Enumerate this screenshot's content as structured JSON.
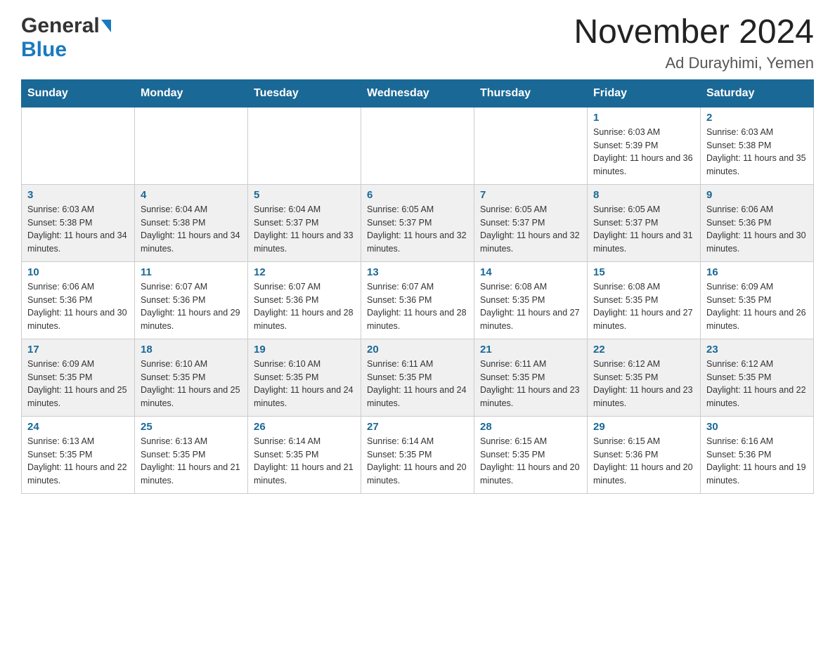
{
  "header": {
    "logo_general": "General",
    "logo_blue": "Blue",
    "title": "November 2024",
    "location": "Ad Durayhimi, Yemen"
  },
  "days_of_week": [
    "Sunday",
    "Monday",
    "Tuesday",
    "Wednesday",
    "Thursday",
    "Friday",
    "Saturday"
  ],
  "weeks": [
    [
      {
        "day": "",
        "sunrise": "",
        "sunset": "",
        "daylight": ""
      },
      {
        "day": "",
        "sunrise": "",
        "sunset": "",
        "daylight": ""
      },
      {
        "day": "",
        "sunrise": "",
        "sunset": "",
        "daylight": ""
      },
      {
        "day": "",
        "sunrise": "",
        "sunset": "",
        "daylight": ""
      },
      {
        "day": "",
        "sunrise": "",
        "sunset": "",
        "daylight": ""
      },
      {
        "day": "1",
        "sunrise": "Sunrise: 6:03 AM",
        "sunset": "Sunset: 5:39 PM",
        "daylight": "Daylight: 11 hours and 36 minutes."
      },
      {
        "day": "2",
        "sunrise": "Sunrise: 6:03 AM",
        "sunset": "Sunset: 5:38 PM",
        "daylight": "Daylight: 11 hours and 35 minutes."
      }
    ],
    [
      {
        "day": "3",
        "sunrise": "Sunrise: 6:03 AM",
        "sunset": "Sunset: 5:38 PM",
        "daylight": "Daylight: 11 hours and 34 minutes."
      },
      {
        "day": "4",
        "sunrise": "Sunrise: 6:04 AM",
        "sunset": "Sunset: 5:38 PM",
        "daylight": "Daylight: 11 hours and 34 minutes."
      },
      {
        "day": "5",
        "sunrise": "Sunrise: 6:04 AM",
        "sunset": "Sunset: 5:37 PM",
        "daylight": "Daylight: 11 hours and 33 minutes."
      },
      {
        "day": "6",
        "sunrise": "Sunrise: 6:05 AM",
        "sunset": "Sunset: 5:37 PM",
        "daylight": "Daylight: 11 hours and 32 minutes."
      },
      {
        "day": "7",
        "sunrise": "Sunrise: 6:05 AM",
        "sunset": "Sunset: 5:37 PM",
        "daylight": "Daylight: 11 hours and 32 minutes."
      },
      {
        "day": "8",
        "sunrise": "Sunrise: 6:05 AM",
        "sunset": "Sunset: 5:37 PM",
        "daylight": "Daylight: 11 hours and 31 minutes."
      },
      {
        "day": "9",
        "sunrise": "Sunrise: 6:06 AM",
        "sunset": "Sunset: 5:36 PM",
        "daylight": "Daylight: 11 hours and 30 minutes."
      }
    ],
    [
      {
        "day": "10",
        "sunrise": "Sunrise: 6:06 AM",
        "sunset": "Sunset: 5:36 PM",
        "daylight": "Daylight: 11 hours and 30 minutes."
      },
      {
        "day": "11",
        "sunrise": "Sunrise: 6:07 AM",
        "sunset": "Sunset: 5:36 PM",
        "daylight": "Daylight: 11 hours and 29 minutes."
      },
      {
        "day": "12",
        "sunrise": "Sunrise: 6:07 AM",
        "sunset": "Sunset: 5:36 PM",
        "daylight": "Daylight: 11 hours and 28 minutes."
      },
      {
        "day": "13",
        "sunrise": "Sunrise: 6:07 AM",
        "sunset": "Sunset: 5:36 PM",
        "daylight": "Daylight: 11 hours and 28 minutes."
      },
      {
        "day": "14",
        "sunrise": "Sunrise: 6:08 AM",
        "sunset": "Sunset: 5:35 PM",
        "daylight": "Daylight: 11 hours and 27 minutes."
      },
      {
        "day": "15",
        "sunrise": "Sunrise: 6:08 AM",
        "sunset": "Sunset: 5:35 PM",
        "daylight": "Daylight: 11 hours and 27 minutes."
      },
      {
        "day": "16",
        "sunrise": "Sunrise: 6:09 AM",
        "sunset": "Sunset: 5:35 PM",
        "daylight": "Daylight: 11 hours and 26 minutes."
      }
    ],
    [
      {
        "day": "17",
        "sunrise": "Sunrise: 6:09 AM",
        "sunset": "Sunset: 5:35 PM",
        "daylight": "Daylight: 11 hours and 25 minutes."
      },
      {
        "day": "18",
        "sunrise": "Sunrise: 6:10 AM",
        "sunset": "Sunset: 5:35 PM",
        "daylight": "Daylight: 11 hours and 25 minutes."
      },
      {
        "day": "19",
        "sunrise": "Sunrise: 6:10 AM",
        "sunset": "Sunset: 5:35 PM",
        "daylight": "Daylight: 11 hours and 24 minutes."
      },
      {
        "day": "20",
        "sunrise": "Sunrise: 6:11 AM",
        "sunset": "Sunset: 5:35 PM",
        "daylight": "Daylight: 11 hours and 24 minutes."
      },
      {
        "day": "21",
        "sunrise": "Sunrise: 6:11 AM",
        "sunset": "Sunset: 5:35 PM",
        "daylight": "Daylight: 11 hours and 23 minutes."
      },
      {
        "day": "22",
        "sunrise": "Sunrise: 6:12 AM",
        "sunset": "Sunset: 5:35 PM",
        "daylight": "Daylight: 11 hours and 23 minutes."
      },
      {
        "day": "23",
        "sunrise": "Sunrise: 6:12 AM",
        "sunset": "Sunset: 5:35 PM",
        "daylight": "Daylight: 11 hours and 22 minutes."
      }
    ],
    [
      {
        "day": "24",
        "sunrise": "Sunrise: 6:13 AM",
        "sunset": "Sunset: 5:35 PM",
        "daylight": "Daylight: 11 hours and 22 minutes."
      },
      {
        "day": "25",
        "sunrise": "Sunrise: 6:13 AM",
        "sunset": "Sunset: 5:35 PM",
        "daylight": "Daylight: 11 hours and 21 minutes."
      },
      {
        "day": "26",
        "sunrise": "Sunrise: 6:14 AM",
        "sunset": "Sunset: 5:35 PM",
        "daylight": "Daylight: 11 hours and 21 minutes."
      },
      {
        "day": "27",
        "sunrise": "Sunrise: 6:14 AM",
        "sunset": "Sunset: 5:35 PM",
        "daylight": "Daylight: 11 hours and 20 minutes."
      },
      {
        "day": "28",
        "sunrise": "Sunrise: 6:15 AM",
        "sunset": "Sunset: 5:35 PM",
        "daylight": "Daylight: 11 hours and 20 minutes."
      },
      {
        "day": "29",
        "sunrise": "Sunrise: 6:15 AM",
        "sunset": "Sunset: 5:36 PM",
        "daylight": "Daylight: 11 hours and 20 minutes."
      },
      {
        "day": "30",
        "sunrise": "Sunrise: 6:16 AM",
        "sunset": "Sunset: 5:36 PM",
        "daylight": "Daylight: 11 hours and 19 minutes."
      }
    ]
  ]
}
